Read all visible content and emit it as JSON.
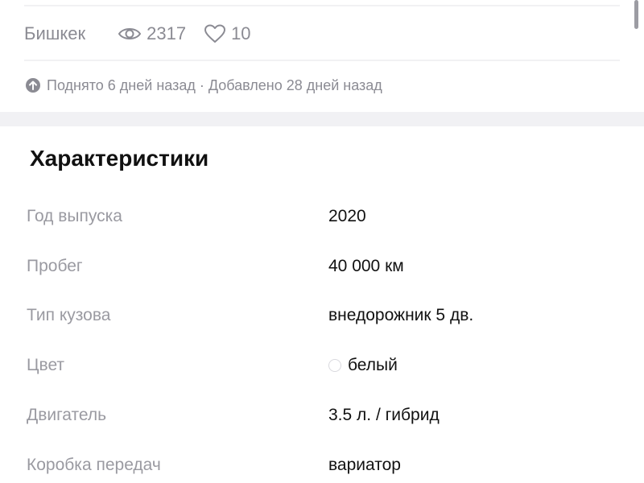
{
  "listing": {
    "city": "Бишкек",
    "views": "2317",
    "likes": "10",
    "raised_info": "Поднято 6 дней назад · Добавлено 28 дней назад"
  },
  "specs": {
    "title": "Характеристики",
    "rows": [
      {
        "label": "Год выпуска",
        "value": "2020"
      },
      {
        "label": "Пробег",
        "value": "40 000 км"
      },
      {
        "label": "Тип кузова",
        "value": "внедорожник 5 дв."
      },
      {
        "label": "Цвет",
        "value": "белый",
        "color_swatch": "#ffffff"
      },
      {
        "label": "Двигатель",
        "value": "3.5 л. / гибрид"
      },
      {
        "label": "Коробка передач",
        "value": "вариатор"
      }
    ]
  }
}
